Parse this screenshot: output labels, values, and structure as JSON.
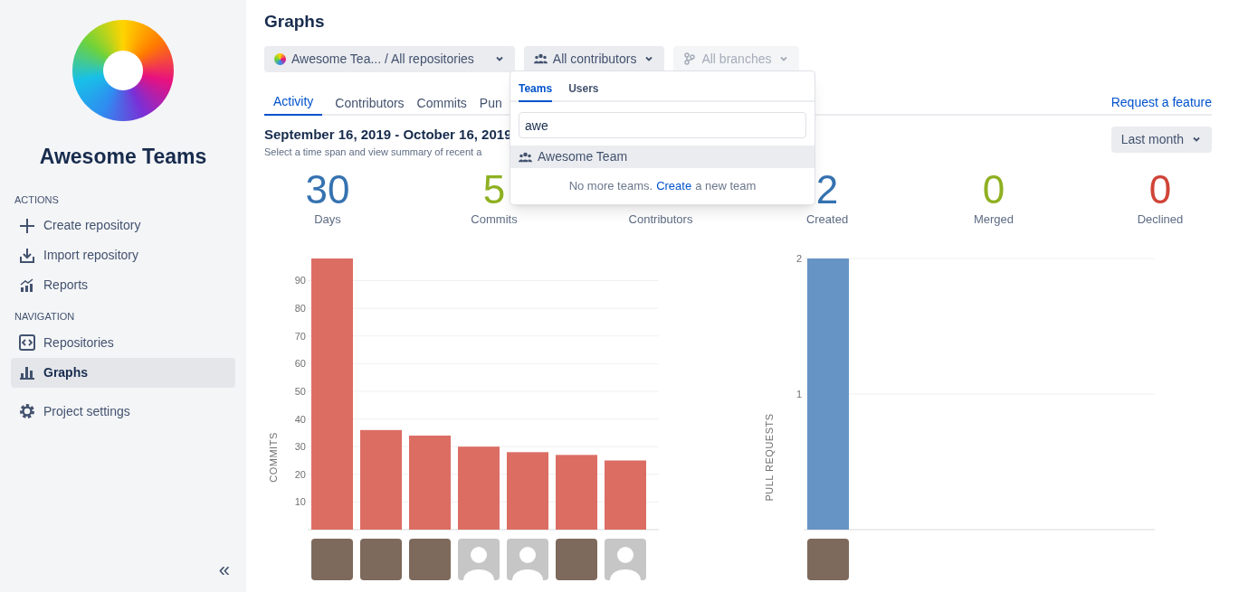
{
  "sidebar": {
    "project_name": "Awesome Teams",
    "sections": [
      {
        "heading": "ACTIONS",
        "items": [
          {
            "label": "Create repository",
            "kind": "plus",
            "selected": false
          },
          {
            "label": "Import repository",
            "kind": "import",
            "selected": false
          },
          {
            "label": "Reports",
            "kind": "reports",
            "selected": false
          }
        ]
      },
      {
        "heading": "NAVIGATION",
        "items": [
          {
            "label": "Repositories",
            "kind": "code",
            "selected": false
          },
          {
            "label": "Graphs",
            "kind": "bars",
            "selected": true
          }
        ]
      },
      {
        "items": [
          {
            "label": "Project settings",
            "kind": "gear",
            "selected": false
          }
        ]
      }
    ],
    "collapse": "«"
  },
  "page": {
    "title": "Graphs",
    "filters": [
      {
        "kind": "repo",
        "label": "Awesome Tea... / All repositories",
        "disabled": false
      },
      {
        "kind": "contributors",
        "label": "All contributors",
        "disabled": false
      },
      {
        "kind": "branches",
        "label": "All branches",
        "disabled": true
      }
    ],
    "tabs": [
      {
        "label": "Activity",
        "selected": true
      },
      {
        "label": "Contributors",
        "selected": false
      },
      {
        "label": "Commits",
        "selected": false
      },
      {
        "label": "Pun",
        "selected": false
      }
    ],
    "request_link": "Request a feature",
    "date_range": "September 16, 2019 - October 16, 2019",
    "subtitle": "Select a time span and view summary of recent a",
    "period_button": "Last month",
    "stats": [
      {
        "value": "30",
        "label": "Days",
        "color": "#3572b0"
      },
      {
        "value": "5",
        "label": "Commits",
        "color": "#8eb021"
      },
      {
        "label": "Contributors"
      },
      {
        "value": "2",
        "label": "Created",
        "color": "#3572b0"
      },
      {
        "value": "0",
        "label": "Merged",
        "color": "#8eb021"
      },
      {
        "value": "0",
        "label": "Declined",
        "color": "#d04437"
      }
    ],
    "commits_chart": {
      "avatars": [
        {
          "kind": "photo"
        },
        {
          "kind": "photo"
        },
        {
          "kind": "photo"
        },
        {
          "kind": "default"
        },
        {
          "kind": "default"
        },
        {
          "kind": "photo"
        },
        {
          "kind": "default"
        }
      ],
      "chart_data": {
        "type": "bar",
        "ylabel": "COMMITS",
        "values": [
          98,
          36,
          34,
          30,
          28,
          27,
          25
        ],
        "yticks": [
          10,
          20,
          30,
          40,
          50,
          60,
          70,
          80,
          90
        ],
        "ylim": [
          0,
          98
        ],
        "grid": true
      }
    },
    "pr_chart": {
      "avatars": [
        {
          "kind": "photo"
        }
      ],
      "chart_data": {
        "type": "bar",
        "ylabel": "PULL REQUESTS",
        "values": [
          2
        ],
        "yticks": [
          1,
          2
        ],
        "ylim": [
          0,
          2
        ],
        "grid": true
      }
    }
  },
  "dropdown": {
    "tabs": [
      {
        "label": "Teams",
        "selected": true
      },
      {
        "label": "Users",
        "selected": false
      }
    ],
    "search_value": "awe",
    "results": [
      {
        "label": "Awesome Team",
        "highlighted": true
      }
    ],
    "footer_text": "No more teams.",
    "footer_link": "Create",
    "footer_after": "a new team"
  }
}
